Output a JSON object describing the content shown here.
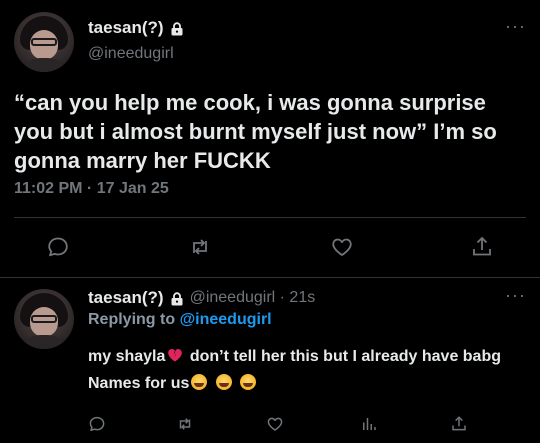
{
  "main_tweet": {
    "display_name": "taesan(?)",
    "handle": "@ineedugirl",
    "text": "“can you help me cook, i was gonna surprise you but i almost burnt myself just now” I’m so gonna marry her FUCKK",
    "timestamp": "11:02 PM · 17 Jan 25",
    "icons": {
      "lock": "lock-icon",
      "more": "more-icon",
      "reply": "reply-icon",
      "retweet": "retweet-icon",
      "like": "like-icon",
      "share": "share-icon"
    }
  },
  "reply_tweet": {
    "display_name": "taesan(?)",
    "handle": "@ineedugirl",
    "time_ago": "· 21s",
    "replying_label": "Replying to",
    "replying_to": "@ineedugirl",
    "text_part1": "my shayla",
    "text_part2": " don’t tell her this but I already have babg Names for us",
    "icons": {
      "lock": "lock-icon",
      "more": "more-icon",
      "broken_heart": "broken-heart-emoji",
      "joy": "face-with-tears-of-joy-emoji",
      "reply": "reply-icon",
      "retweet": "retweet-icon",
      "like": "like-icon",
      "analytics": "analytics-icon",
      "share": "share-icon"
    }
  },
  "colors": {
    "background": "#000000",
    "text": "#e7e9ea",
    "muted": "#71767b",
    "link": "#1d9bf0",
    "divider": "#2f3336"
  }
}
